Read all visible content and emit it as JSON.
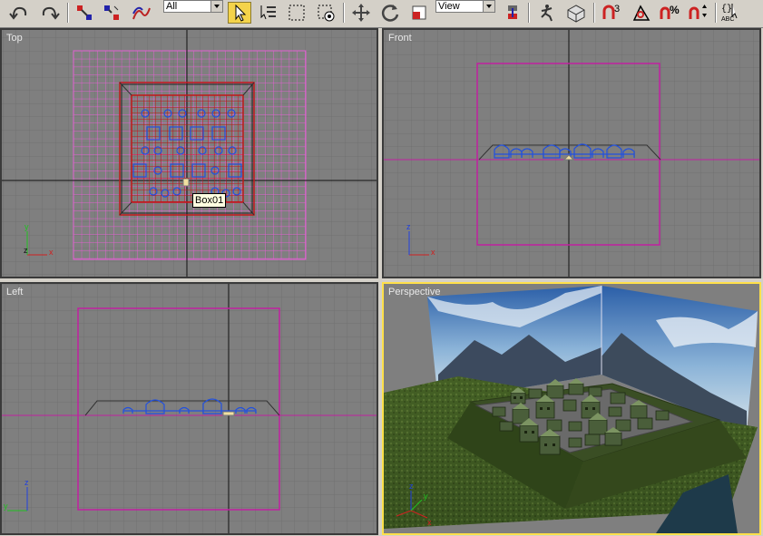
{
  "toolbar": {
    "selection_filter": "All",
    "reference_coord": "View",
    "icons": [
      "undo-icon",
      "redo-icon",
      "select-link-icon",
      "unlink-icon",
      "bind-spacewarp-icon",
      "select-object-icon",
      "select-by-name-icon",
      "rectangular-selection-icon",
      "window-crossing-icon",
      "move-icon",
      "rotate-icon",
      "scale-icon",
      "pivot-center-icon",
      "manipulate-icon",
      "keyboard-shortcut-icon",
      "snap-3d-icon",
      "angle-snap-icon",
      "percent-snap-icon",
      "spinner-snap-icon",
      "named-selection-icon"
    ],
    "snap_label": "3",
    "percent_label": "%",
    "abc_label": "ABC"
  },
  "viewports": {
    "top": {
      "label": "Top"
    },
    "front": {
      "label": "Front"
    },
    "left": {
      "label": "Left"
    },
    "perspective": {
      "label": "Perspective"
    }
  },
  "tooltip": {
    "text": "Box01"
  },
  "axis": {
    "x": "x",
    "y": "y",
    "z": "z"
  },
  "colors": {
    "viewport_bg": "#7f7f7f",
    "grid": "#6e6e6e",
    "axis_line": "#1a1a1a",
    "magenta": "#e040c0",
    "blue_obj": "#2050e0",
    "active_border": "#ffe04a"
  }
}
